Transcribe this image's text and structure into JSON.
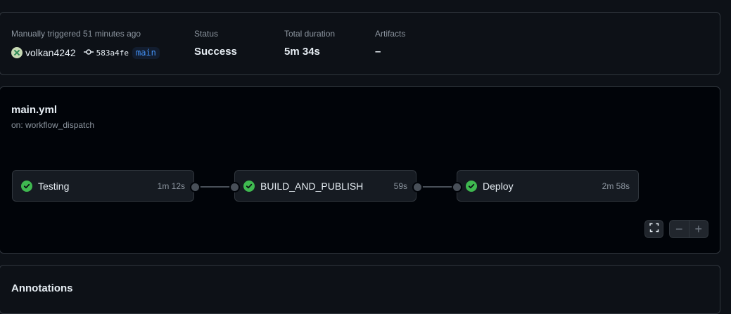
{
  "summary": {
    "trigger_text": "Manually triggered 51 minutes ago",
    "user": "volkan4242",
    "commit_sha": "583a4fe",
    "branch": "main",
    "status_label": "Status",
    "status_value": "Success",
    "duration_label": "Total duration",
    "duration_value": "5m 34s",
    "artifacts_label": "Artifacts",
    "artifacts_value": "–"
  },
  "workflow": {
    "file": "main.yml",
    "trigger": "on: workflow_dispatch",
    "jobs": [
      {
        "name": "Testing",
        "duration": "1m 12s",
        "status": "success"
      },
      {
        "name": "BUILD_AND_PUBLISH",
        "duration": "59s",
        "status": "success"
      },
      {
        "name": "Deploy",
        "duration": "2m 58s",
        "status": "success"
      }
    ],
    "zoom_out_label": "−",
    "zoom_in_label": "+"
  },
  "annotations": {
    "title": "Annotations"
  },
  "colors": {
    "success": "#3fb950",
    "branch_text": "#4493f8"
  }
}
